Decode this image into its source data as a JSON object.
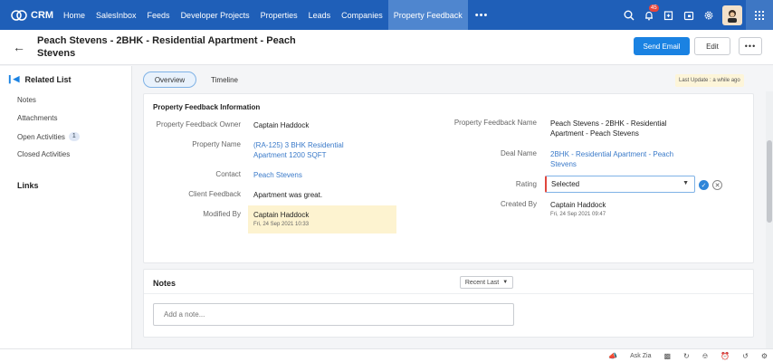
{
  "app": {
    "name": "CRM"
  },
  "nav": {
    "items": [
      "Home",
      "SalesInbox",
      "Feeds",
      "Developer Projects",
      "Properties",
      "Leads",
      "Companies",
      "Property Feedback"
    ],
    "more": "•••",
    "active_color": "#4f86cf",
    "bar_color": "#1f5fb8"
  },
  "top_icons": {
    "notification_count": "45"
  },
  "header": {
    "title": "Peach Stevens - 2BHK - Residential Apartment - Peach Stevens",
    "send_email": "Send Email",
    "edit": "Edit",
    "more": "•••"
  },
  "sidebar": {
    "related_list": "Related List",
    "items": [
      {
        "label": "Notes",
        "badge": ""
      },
      {
        "label": "Attachments",
        "badge": ""
      },
      {
        "label": "Open Activities",
        "badge": "1"
      },
      {
        "label": "Closed Activities",
        "badge": ""
      }
    ],
    "links": "Links"
  },
  "tabs": {
    "overview": "Overview",
    "timeline": "Timeline"
  },
  "last_update": "Last Update : a while ago",
  "info": {
    "title": "Property Feedback Information",
    "owner_label": "Property Feedback Owner",
    "owner_value": "Captain Haddock",
    "property_name_label": "Property Name",
    "property_name_value": "(RA-125) 3 BHK Residential Apartment 1200 SQFT",
    "contact_label": "Contact",
    "contact_value": "Peach Stevens",
    "client_feedback_label": "Client Feedback",
    "client_feedback_value": "Apartment was great.",
    "modified_by_label": "Modified By",
    "modified_by_value": "Captain Haddock",
    "modified_by_date": "Fri, 24 Sep 2021 10:33",
    "feedback_name_label": "Property Feedback Name",
    "feedback_name_value": "Peach Stevens - 2BHK - Residential Apartment - Peach Stevens",
    "deal_name_label": "Deal Name",
    "deal_name_value": "2BHK - Residential Apartment - Peach Stevens",
    "rating_label": "Rating",
    "rating_value": "Selected",
    "created_by_label": "Created By",
    "created_by_value": "Captain Haddock",
    "created_by_date": "Fri, 24 Sep 2021 09:47"
  },
  "notes": {
    "title": "Notes",
    "sort": "Recent Last",
    "placeholder": "Add a note..."
  },
  "bottom": {
    "ask_zia": "Ask Zia"
  }
}
